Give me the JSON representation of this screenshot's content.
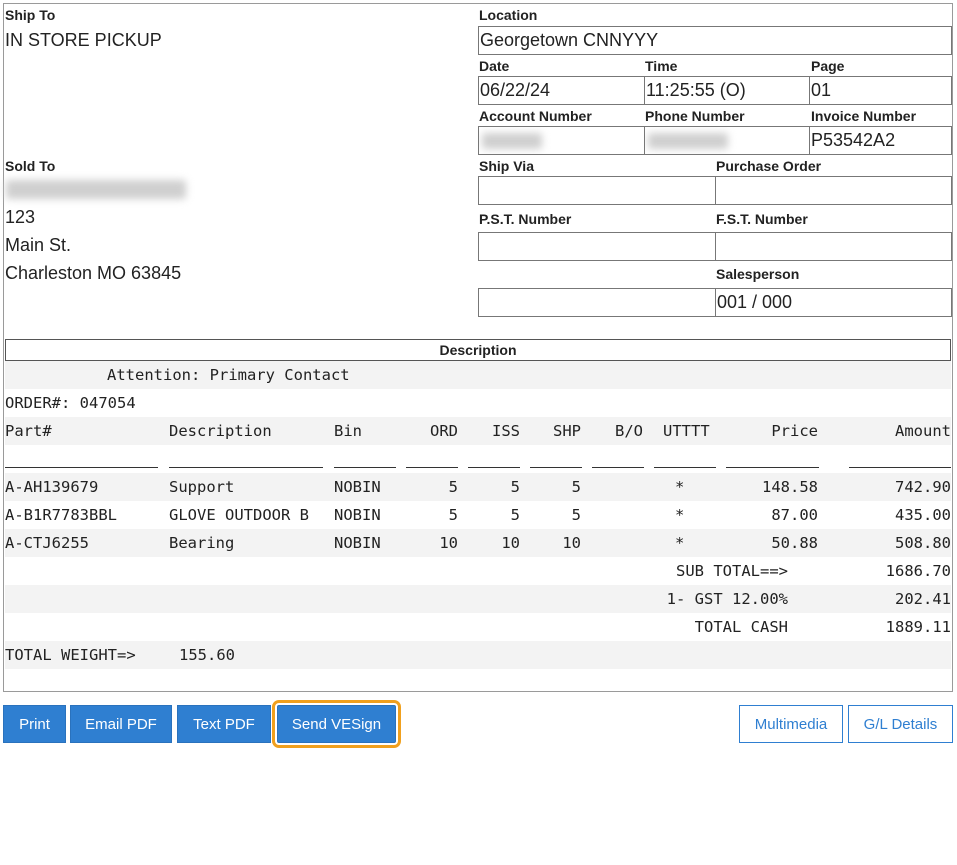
{
  "ship_to": {
    "label": "Ship To",
    "value": "IN STORE PICKUP"
  },
  "sold_to": {
    "label": "Sold To",
    "address": [
      "123",
      "Main St.",
      "Charleston MO 63845"
    ]
  },
  "location": {
    "label": "Location",
    "value": "Georgetown CNNYYY"
  },
  "date": {
    "label": "Date",
    "value": "06/22/24"
  },
  "time": {
    "label": "Time",
    "value": "11:25:55 (O)"
  },
  "page": {
    "label": "Page",
    "value": "01"
  },
  "account": {
    "label": "Account Number"
  },
  "phone": {
    "label": "Phone Number"
  },
  "invoice": {
    "label": "Invoice Number",
    "value": "P53542A2"
  },
  "ship_via": {
    "label": "Ship Via",
    "value": ""
  },
  "purchase_order": {
    "label": "Purchase Order",
    "value": ""
  },
  "pst": {
    "label": "P.S.T. Number",
    "value": ""
  },
  "fst": {
    "label": "F.S.T. Number",
    "value": ""
  },
  "salesperson": {
    "label": "Salesperson",
    "value": "001 / 000"
  },
  "description": {
    "header": "Description",
    "attention": "Attention: Primary Contact",
    "order": "ORDER#: 047054",
    "columns": [
      "Part#",
      "Description",
      "Bin",
      "ORD",
      "ISS",
      "SHP",
      "B/O",
      "UTTTT",
      "Price",
      "Amount"
    ],
    "items": [
      {
        "part": "A-AH139679",
        "desc": "Support",
        "bin": "NOBIN",
        "ord": "5",
        "iss": "5",
        "shp": "5",
        "bo": "",
        "uttt": "*",
        "price": "148.58",
        "amount": "742.90"
      },
      {
        "part": "A-B1R7783BBL",
        "desc": "GLOVE OUTDOOR B",
        "bin": "NOBIN",
        "ord": "5",
        "iss": "5",
        "shp": "5",
        "bo": "",
        "uttt": "*",
        "price": "87.00",
        "amount": "435.00"
      },
      {
        "part": "A-CTJ6255",
        "desc": "Bearing",
        "bin": "NOBIN",
        "ord": "10",
        "iss": "10",
        "shp": "10",
        "bo": "",
        "uttt": "*",
        "price": "50.88",
        "amount": "508.80"
      }
    ],
    "totals": [
      {
        "label": "SUB TOTAL==>",
        "value": "1686.70"
      },
      {
        "label": "1- GST 12.00%",
        "value": "202.41"
      },
      {
        "label": "TOTAL CASH",
        "value": "1889.11"
      }
    ],
    "weight_label": "TOTAL WEIGHT=>",
    "weight_value": "155.60"
  },
  "buttons": {
    "print": "Print",
    "email_pdf": "Email PDF",
    "text_pdf": "Text PDF",
    "send_vesign": "Send VESign",
    "multimedia": "Multimedia",
    "gl_details": "G/L Details"
  },
  "colors": {
    "primary": "#2f7fd1",
    "highlight": "#f0a01e"
  }
}
